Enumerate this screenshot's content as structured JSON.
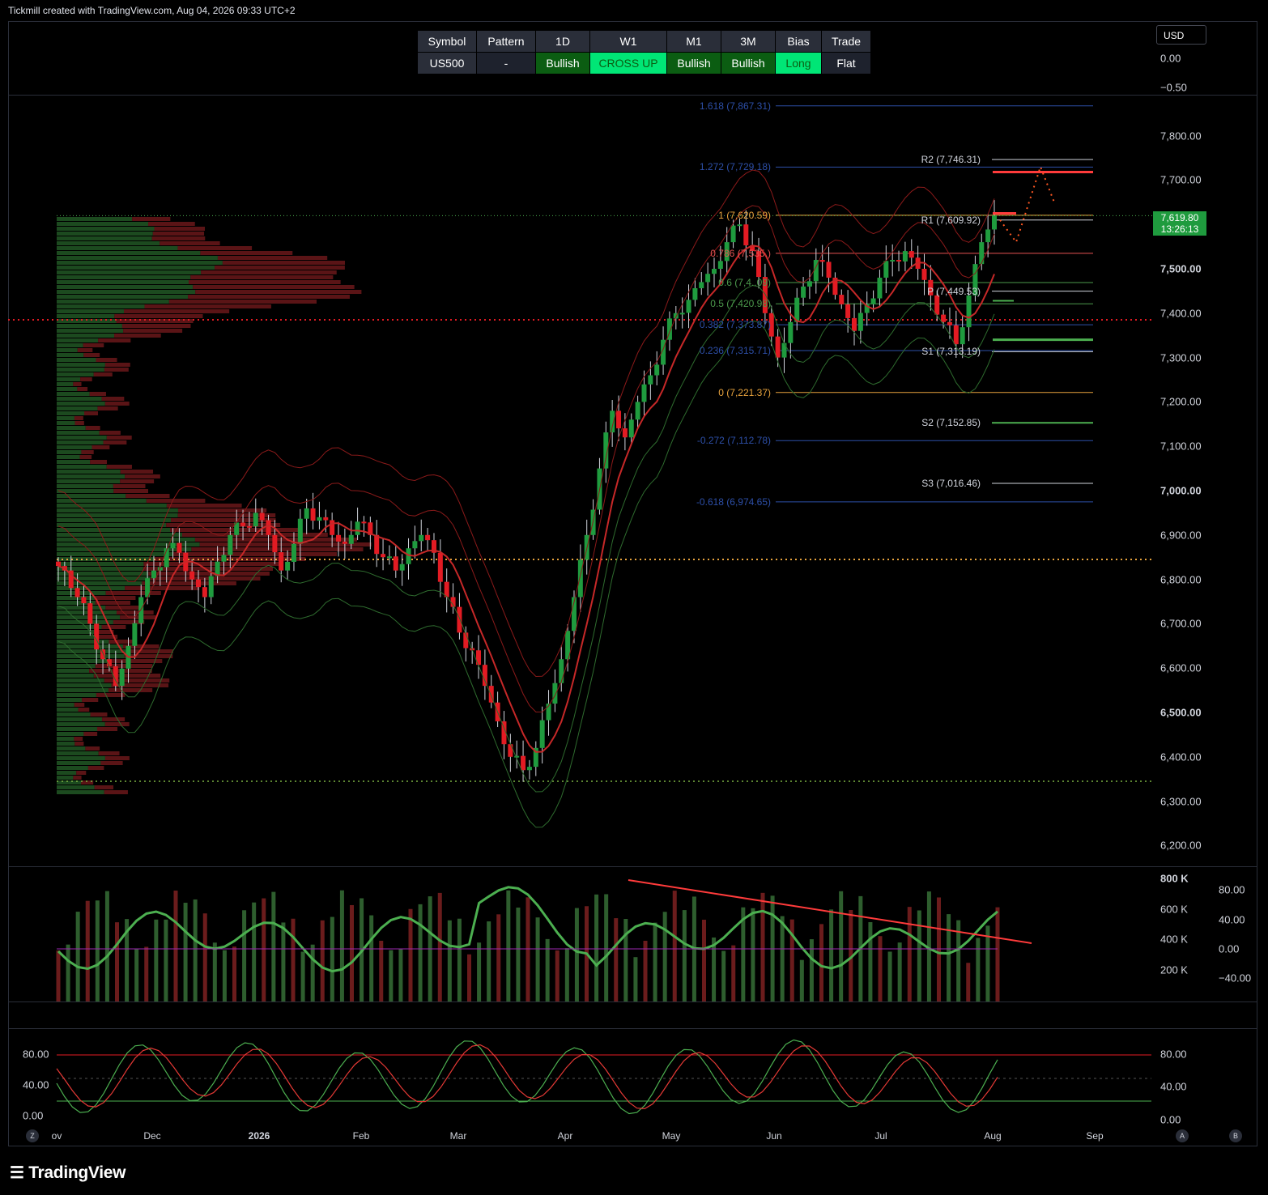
{
  "header": {
    "text": "Tickmill created with TradingView.com, Aug 04, 2026 09:33 UTC+2"
  },
  "status_table": {
    "headers": [
      "Symbol",
      "Pattern",
      "1D",
      "W1",
      "M1",
      "3M",
      "Bias",
      "Trade"
    ],
    "values": [
      "US500",
      "-",
      "Bullish",
      "CROSS UP",
      "Bullish",
      "Bullish",
      "Long",
      "Flat"
    ],
    "value_colors": [
      "#2a2e39",
      "#1e222d",
      "#0b5d12",
      "#00e676",
      "#0b5d12",
      "#0b5d12",
      "#00e676",
      "#1e222d"
    ],
    "value_text_colors": [
      "#ffffff",
      "#ffffff",
      "#ffffff",
      "#0b5d12",
      "#ffffff",
      "#ffffff",
      "#0b5d12",
      "#ffffff"
    ]
  },
  "currency_button": "USD",
  "top_pane_axis": [
    "0.00",
    "−0.50"
  ],
  "price_axis": [
    "7,800.00",
    "7,700.00",
    "7,500.00",
    "7,400.00",
    "7,300.00",
    "7,200.00",
    "7,100.00",
    "7,000.00",
    "6,900.00",
    "6,800.00",
    "6,700.00",
    "6,600.00",
    "6,500.00",
    "6,400.00",
    "6,300.00",
    "6,200.00"
  ],
  "current_price": {
    "price": "7,619.80",
    "countdown": "13:26:13",
    "color": "#1f9b3e"
  },
  "fib_labels": [
    "1.618 (7,867.31)",
    "1.272 (7,729.18)",
    "1 (7,620.59)",
    "0.786 (7,535.)",
    "0.6 (7,4..09)",
    "0.5 (7,420.98)",
    "0.382 (7,373.87)",
    "0.236 (7,315.71)",
    "0 (7,221.37)",
    "-0.272 (7,112.78)",
    "-0.618 (6,974.65)"
  ],
  "pivot_labels": [
    "R2 (7,746.31)",
    "R1 (7,609.92)",
    "P (7,449.53)",
    "S1 (7,313.19)",
    "S2 (7,152.85)",
    "S3 (7,016.46)"
  ],
  "volume_axis_left": [
    "800 K",
    "600 K",
    "400 K",
    "200 K"
  ],
  "rsi_axis_right": [
    "80.00",
    "40.00",
    "0.00",
    "−40.00"
  ],
  "stoch_axis_left": [
    "80.00",
    "40.00",
    "0.00"
  ],
  "stoch_axis_right": [
    "80.00",
    "40.00",
    "0.00"
  ],
  "time_axis": [
    "ov",
    "Dec",
    "2026",
    "Feb",
    "Mar",
    "Apr",
    "May",
    "Jun",
    "Jul",
    "Aug",
    "Sep"
  ],
  "bottom_buttons": [
    "Z",
    "A",
    "B"
  ],
  "logo": "TradingView",
  "colors": {
    "bull": "#1f9b3e",
    "bear": "#e31b23",
    "fib_blue": "#2d4fa8",
    "fib_orange": "#e8a33d",
    "fib_red": "#e55353",
    "fib_green": "#4c9a4c"
  },
  "chart_data": {
    "type": "candlestick",
    "symbol": "US500",
    "y_range": [
      6150,
      7900
    ],
    "approx_closes": [
      6820,
      6760,
      6700,
      6620,
      6560,
      6650,
      6760,
      6820,
      6870,
      6860,
      6800,
      6760,
      6840,
      6900,
      6920,
      6950,
      6900,
      6820,
      6880,
      6960,
      6940,
      6900,
      6880,
      6930,
      6900,
      6850,
      6820,
      6870,
      6900,
      6860,
      6760,
      6680,
      6640,
      6560,
      6480,
      6400,
      6370,
      6420,
      6520,
      6620,
      6760,
      6900,
      7050,
      7180,
      7120,
      7200,
      7260,
      7340,
      7400,
      7430,
      7470,
      7500,
      7560,
      7600,
      7540,
      7400,
      7300,
      7380,
      7460,
      7520,
      7480,
      7420,
      7360,
      7420,
      7480,
      7520,
      7540,
      7500,
      7440,
      7380,
      7330,
      7440,
      7560,
      7620
    ]
  }
}
